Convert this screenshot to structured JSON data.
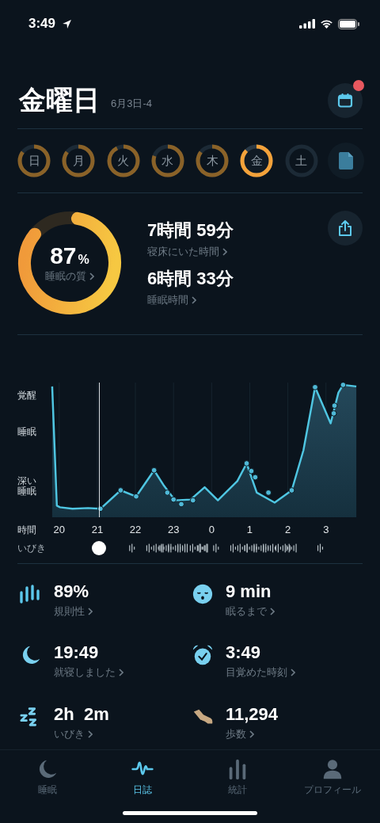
{
  "status_bar": {
    "time": "3:49"
  },
  "header": {
    "title": "金曜日",
    "subtitle": "6月3日-4",
    "calendar_badge": true
  },
  "days": [
    {
      "label": "日",
      "selected": false
    },
    {
      "label": "月",
      "selected": false
    },
    {
      "label": "火",
      "selected": false
    },
    {
      "label": "水",
      "selected": false
    },
    {
      "label": "木",
      "selected": false
    },
    {
      "label": "金",
      "selected": true
    },
    {
      "label": "土",
      "selected": false
    }
  ],
  "summary": {
    "score": "87",
    "unit": "%",
    "score_label": "睡眠の質",
    "items": [
      {
        "value": "7時間 59分",
        "label": "寝床にいた時間"
      },
      {
        "value": "6時間 33分",
        "label": "睡眠時間"
      }
    ]
  },
  "sleep_graph": {
    "stage_labels": [
      "覚醒",
      "睡眠",
      "深い睡眠"
    ],
    "time_label": "時間",
    "hours": [
      "20",
      "21",
      "22",
      "23",
      "0",
      "1",
      "2",
      "3"
    ],
    "snore_label": "いびき"
  },
  "stats": [
    {
      "value": "89%",
      "label": "規則性"
    },
    {
      "value": "9 min",
      "label": "眠るまで"
    },
    {
      "value": "19:49",
      "label": "就寝しました"
    },
    {
      "value": "3:49",
      "label": "目覚めた時刻"
    },
    {
      "value": "2h  2m",
      "label": "いびき"
    },
    {
      "value": "11,294",
      "label": "歩数"
    }
  ],
  "tab_bar": [
    {
      "label": "睡眠",
      "selected": false
    },
    {
      "label": "日誌",
      "selected": true
    },
    {
      "label": "統計",
      "selected": false
    },
    {
      "label": "プロフィール",
      "selected": false
    }
  ]
}
